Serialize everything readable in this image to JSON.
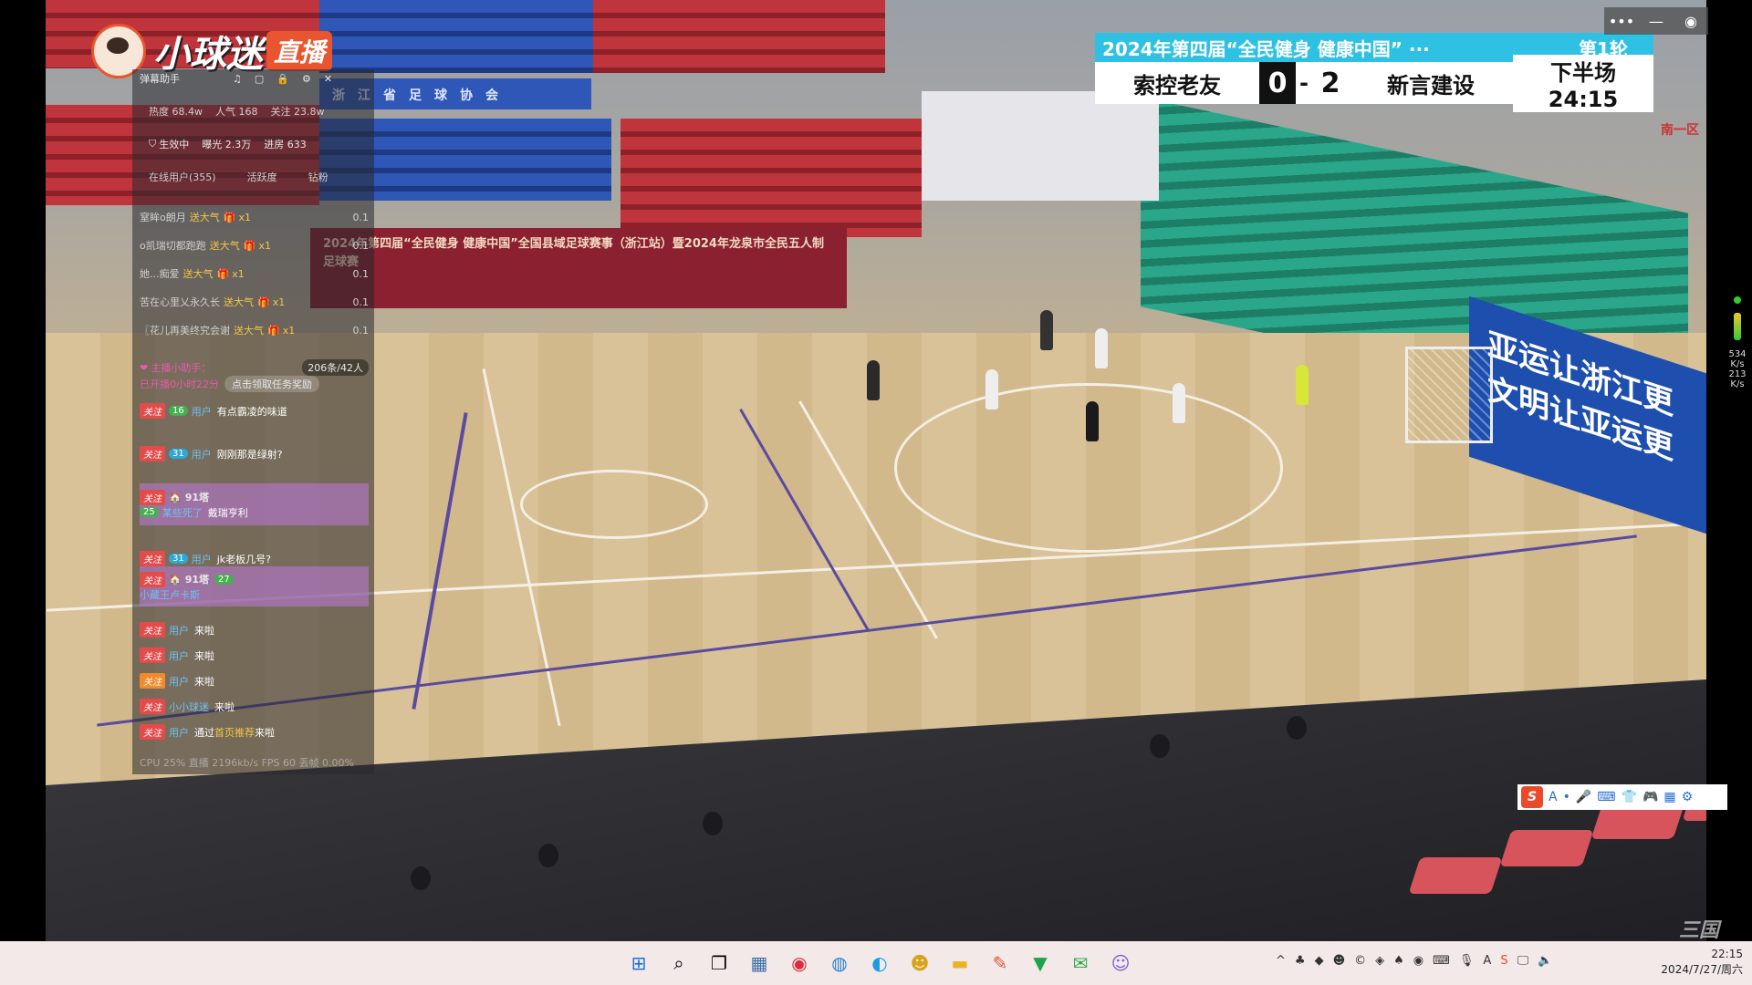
{
  "logo": {
    "brand": "小球迷",
    "live": "直播"
  },
  "window_controls": {
    "more": "•••",
    "minimize": "—",
    "record": "◉"
  },
  "scoreboard": {
    "title": "2024年第四届“全民健身 健康中国” ···",
    "round": "第1轮",
    "team_a": "索控老友",
    "score_a": "0",
    "separator": "-",
    "score_b": "2",
    "team_b": "新言建设",
    "period": "下半场 24:15"
  },
  "video": {
    "banner_top": "浙　江　省　足　球　协　会",
    "banner_main": "2024年第四届“全民健身 健康中国”全国县域足球赛事（浙江站）暨2024年龙泉市全民五人制足球赛",
    "slogan_lines": [
      "亚运让浙江更",
      "文明让亚运更"
    ],
    "right_tag": "南一区",
    "watermark": "三国"
  },
  "danmu_panel": {
    "title": "弹幕助手",
    "stats": {
      "heat": "热度 68.4w",
      "popularity": "人气 168",
      "follows": "关注 23.8w"
    },
    "effect": {
      "label": "生效中",
      "exposure": "曝光 2.3万",
      "entries": "进房 633"
    },
    "tabs": [
      "在线用户(355)",
      "活跃度",
      "钻粉"
    ],
    "gifts": [
      {
        "user": "窒眸o朗月",
        "action": "送",
        "gift": "大气",
        "count": "x1",
        "value": "0.1"
      },
      {
        "user": "o凯瑞切都跑跑",
        "action": "送",
        "gift": "大气",
        "count": "x1",
        "value": "0.1"
      },
      {
        "user": "她...痴爱",
        "action": "送",
        "gift": "大气",
        "count": "x1",
        "value": "0.1"
      },
      {
        "user": "苦在心里乂永久长",
        "action": "送",
        "gift": "大气",
        "count": "x1",
        "value": "0.1"
      },
      {
        "user": "〖花儿再美终究会谢",
        "action": "送",
        "gift": "大气",
        "count": "x1",
        "value": "0.1"
      }
    ],
    "task": {
      "line1": "主播小助手：",
      "line2": "已开播0小时22分",
      "counter": "206条/42人",
      "button": "点击领取任务奖励"
    },
    "messages": [
      {
        "tag": "关注",
        "level": "16",
        "user": "用户",
        "text": "有点霸凌的味道"
      },
      {
        "tag": "关注",
        "level": "31",
        "user": "用户",
        "text": "刚刚那是绿射?"
      },
      {
        "tag": "关注",
        "level": "25",
        "user": "某些死了",
        "text": "戴瑞亨利",
        "badge": "91塔"
      },
      {
        "tag": "关注",
        "level": "31",
        "user": "用户",
        "text": "jk老板几号?"
      },
      {
        "tag": "关注",
        "level": "27",
        "user": "小藏王卢卡斯",
        "text": "",
        "badge": "91塔"
      },
      {
        "tag": "关注",
        "user": "用户",
        "text": "来啦"
      },
      {
        "tag": "关注",
        "user": "用户",
        "text": "来啦"
      },
      {
        "tag": "关注",
        "user": "用户",
        "text": "来啦"
      },
      {
        "tag": "关注",
        "user": "小小球迷",
        "text": "来啦"
      },
      {
        "tag": "关注",
        "user": "用户",
        "text": "通过",
        "extra": "首页推荐",
        "tail": "来啦"
      }
    ],
    "footer": "CPU 25%  直播 2196kb/s  FPS 60  丢帧 0.00%"
  },
  "ime_bar": {
    "logo": "S",
    "items": [
      "A",
      "•",
      "🎤",
      "⌨",
      "👕",
      "🎮",
      "▦",
      "⚙"
    ]
  },
  "meter": {
    "up": "534",
    "up_unit": "K/s",
    "down": "213",
    "down_unit": "K/s"
  },
  "taskbar": {
    "center_icons": [
      "windows-start",
      "search",
      "task-view",
      "calculator",
      "netease-music",
      "edge-dev",
      "edge",
      "cartoon-app",
      "file-explorer",
      "paint-app",
      "terminal-app",
      "wechat",
      "chat-app"
    ],
    "tray_text": "^",
    "time": "22:15",
    "date": "2024/7/27/周六"
  },
  "colors": {
    "scoreboard_accent": "#2fc1e4",
    "live_orange": "#e9552e",
    "taskbar_bg": "#f3e9e9"
  }
}
